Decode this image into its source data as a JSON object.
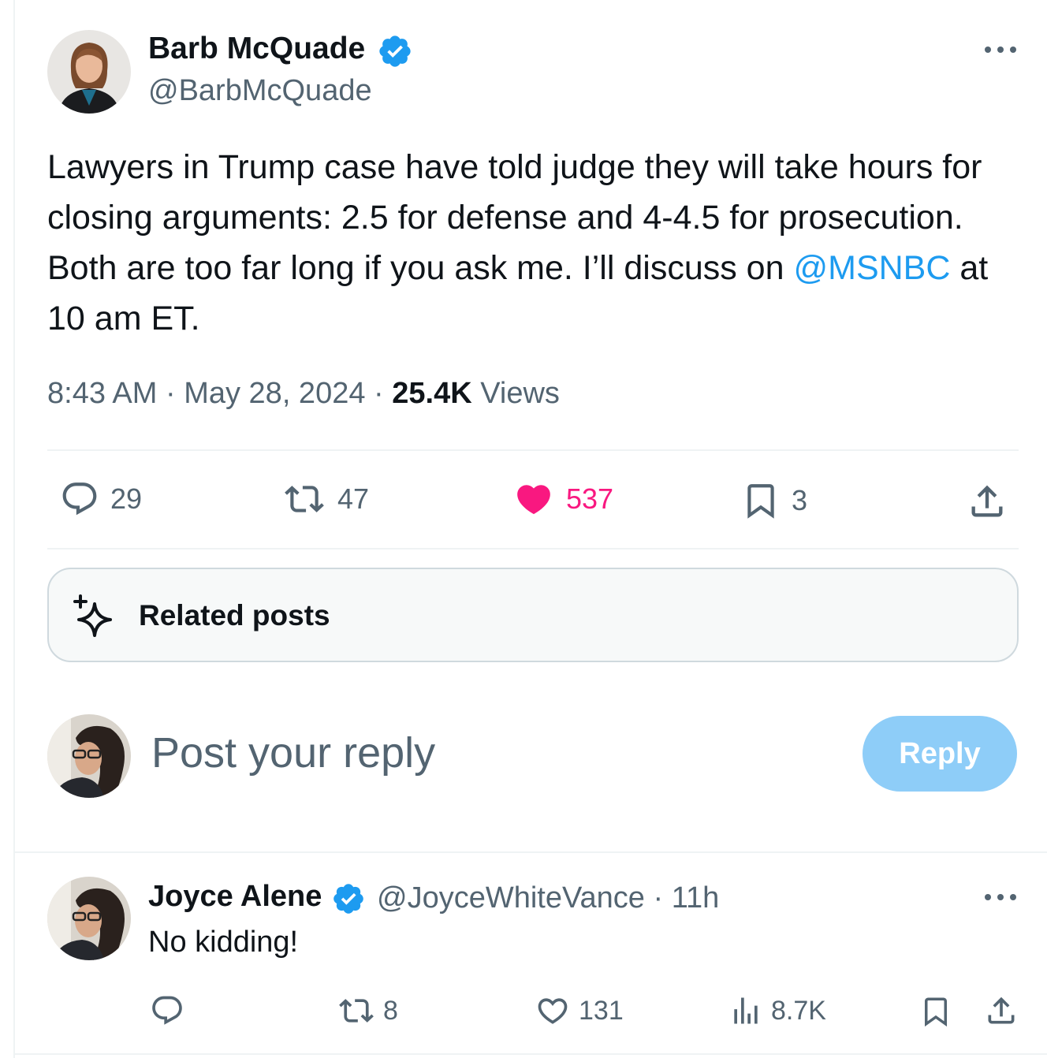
{
  "main_post": {
    "author_name": "Barb McQuade",
    "author_handle": "@BarbMcQuade",
    "text_before_mention": "Lawyers in Trump case have told judge they will take hours for closing arguments: 2.5 for defense and 4-4.5 for prosecution. Both are too far long if you ask me. I’ll discuss on ",
    "mention": "@MSNBC",
    "text_after_mention": " at 10 am ET.",
    "time": "8:43 AM",
    "separator": "·",
    "date": "May 28, 2024",
    "views_count": "25.4K",
    "views_label": "Views",
    "metrics": {
      "replies": "29",
      "reposts": "47",
      "likes": "537",
      "bookmarks": "3"
    }
  },
  "related_posts": {
    "label": "Related posts",
    "icon": "sparkle-icon"
  },
  "composer": {
    "placeholder": "Post your reply",
    "button_label": "Reply"
  },
  "reply_post": {
    "author_name": "Joyce Alene",
    "author_handle": "@JoyceWhiteVance",
    "separator": "·",
    "age": "11h",
    "text": "No kidding!",
    "metrics": {
      "reposts": "8",
      "likes": "131",
      "views": "8.7K"
    }
  },
  "colors": {
    "accent": "#1d9bf0",
    "like_active": "#f91880",
    "secondary_text": "#536471",
    "reply_button_disabled": "#8ecdf8"
  },
  "icons": [
    "verified-badge-icon",
    "more-icon",
    "reply-icon",
    "repost-icon",
    "heart-filled-icon",
    "heart-icon",
    "bookmark-icon",
    "share-icon",
    "views-icon",
    "sparkle-icon"
  ]
}
